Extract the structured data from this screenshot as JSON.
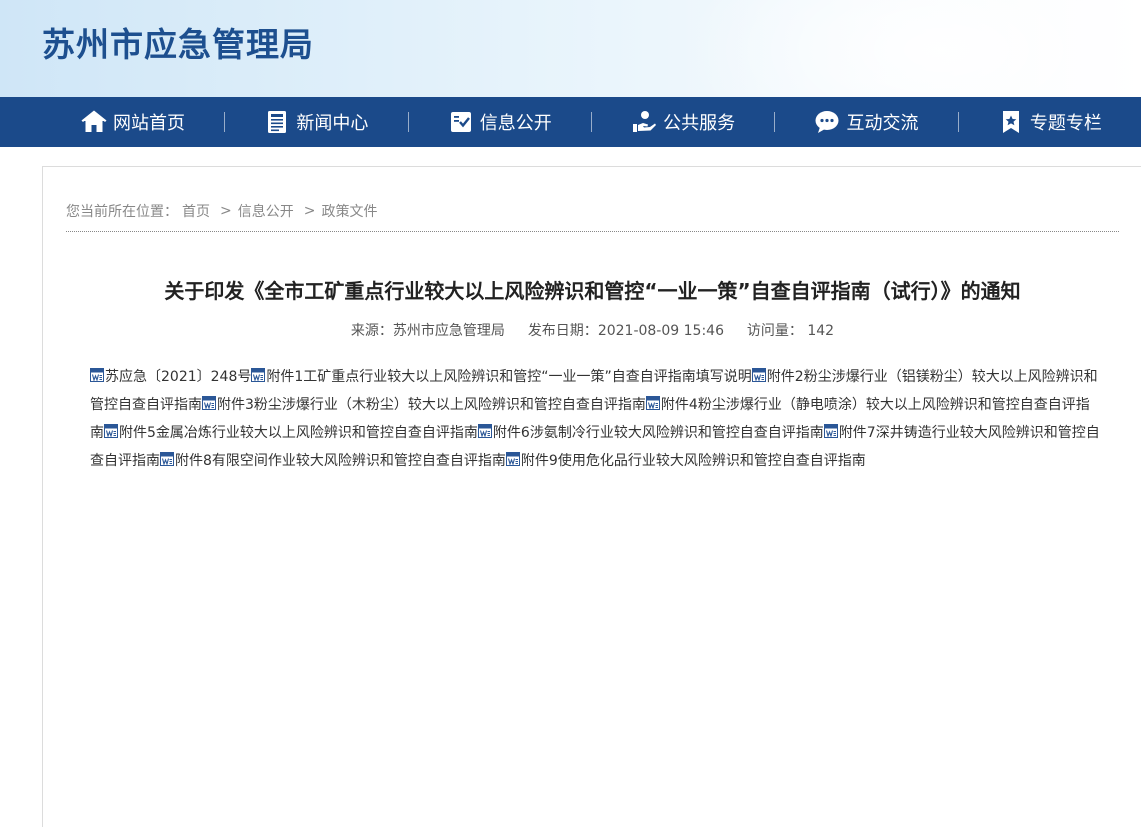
{
  "header": {
    "site_title": "苏州市应急管理局"
  },
  "nav": {
    "items": [
      {
        "label": "网站首页",
        "icon": "home-icon"
      },
      {
        "label": "新闻中心",
        "icon": "news-icon"
      },
      {
        "label": "信息公开",
        "icon": "info-check-icon"
      },
      {
        "label": "公共服务",
        "icon": "service-hand-icon"
      },
      {
        "label": "互动交流",
        "icon": "chat-icon"
      },
      {
        "label": "专题专栏",
        "icon": "bookmark-star-icon"
      }
    ]
  },
  "breadcrumb": {
    "prefix": "您当前所在位置：",
    "items": [
      "首页",
      "信息公开",
      "政策文件"
    ],
    "separator": ">"
  },
  "article": {
    "title": "关于印发《全市工矿重点行业较大以上风险辨识和管控“一业一策”自查自评指南（试行）》的通知",
    "meta": {
      "source_label": "来源：",
      "source": "苏州市应急管理局",
      "date_label": "发布日期：",
      "date": "2021-08-09 15:46",
      "views_label": "访问量：",
      "views": "142"
    },
    "attachments": [
      "苏应急〔2021〕248号",
      "附件1工矿重点行业较大以上风险辨识和管控“一业一策”自查自评指南填写说明",
      "附件2粉尘涉爆行业（铝镁粉尘）较大以上风险辨识和管控自查自评指南",
      "附件3粉尘涉爆行业（木粉尘）较大以上风险辨识和管控自查自评指南",
      "附件4粉尘涉爆行业（静电喷涂）较大以上风险辨识和管控自查自评指南",
      "附件5金属冶炼行业较大以上风险辨识和管控自查自评指南",
      "附件6涉氨制冷行业较大风险辨识和管控自查自评指南",
      "附件7深井铸造行业较大风险辨识和管控自查自评指南",
      "附件8有限空间作业较大风险辨识和管控自查自评指南",
      "附件9使用危化品行业较大风险辨识和管控自查自评指南"
    ]
  },
  "colors": {
    "nav_bg": "#1b4a8a",
    "title": "#1d4f8f",
    "word_icon": "#2b5797"
  }
}
